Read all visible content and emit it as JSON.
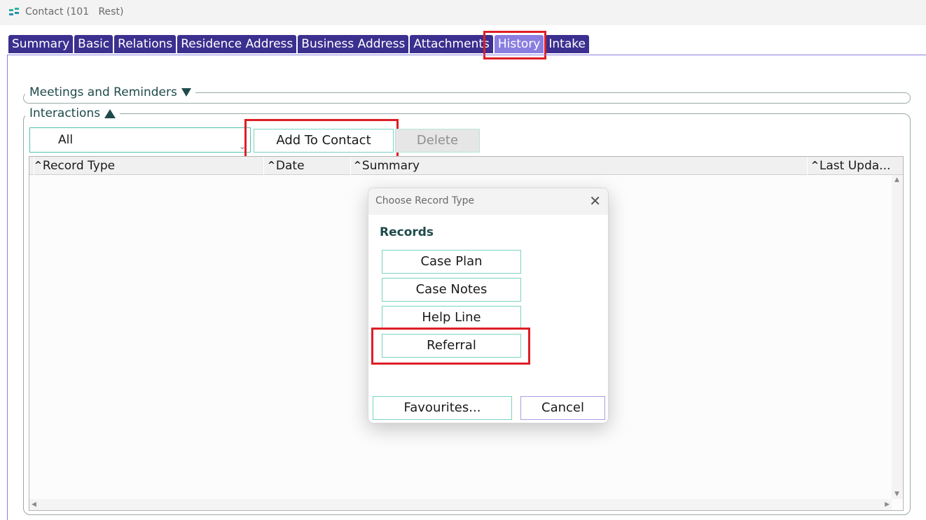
{
  "window": {
    "title": "Contact (101   Rest)"
  },
  "tabs": [
    {
      "label": "Summary",
      "active": false
    },
    {
      "label": "Basic",
      "active": false
    },
    {
      "label": "Relations",
      "active": false
    },
    {
      "label": "Residence Address",
      "active": false
    },
    {
      "label": "Business Address",
      "active": false
    },
    {
      "label": "Attachments",
      "active": false
    },
    {
      "label": "History",
      "active": true
    },
    {
      "label": "Intake",
      "active": false
    }
  ],
  "sections": {
    "meetings": "Meetings and Reminders",
    "interactions": "Interactions"
  },
  "filter": {
    "value": "All"
  },
  "buttons": {
    "add_to_contact": "Add To Contact",
    "delete": "Delete"
  },
  "grid": {
    "columns": [
      "Record Type",
      "Date",
      "Summary",
      "Last Upda..."
    ],
    "rows": []
  },
  "dialog": {
    "title": "Choose Record Type",
    "section_label": "Records",
    "options": [
      "Case Plan",
      "Case Notes",
      "Help Line",
      "Referral"
    ],
    "favourites": "Favourites...",
    "cancel": "Cancel"
  },
  "colors": {
    "tab_bg": "#3b2f8f",
    "tab_active_bg": "#8a7ee0",
    "teal_border": "#4fc3b1",
    "highlight": "#dd1f26"
  },
  "icons": {
    "app": "app-logo-icon",
    "close": "close-icon",
    "collapse": "triangle-down-icon",
    "expand": "triangle-up-icon"
  }
}
